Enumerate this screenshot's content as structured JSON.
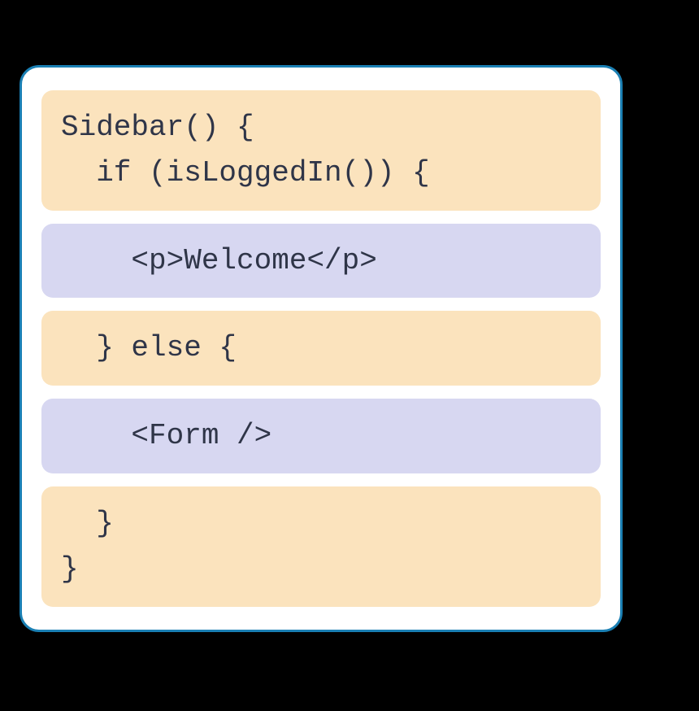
{
  "blocks": [
    {
      "type": "orange",
      "text": "Sidebar() {\n  if (isLoggedIn()) {"
    },
    {
      "type": "purple",
      "text": "    <p>Welcome</p>"
    },
    {
      "type": "orange",
      "text": "  } else {"
    },
    {
      "type": "purple",
      "text": "    <Form />"
    },
    {
      "type": "orange",
      "text": "  }\n}"
    }
  ]
}
